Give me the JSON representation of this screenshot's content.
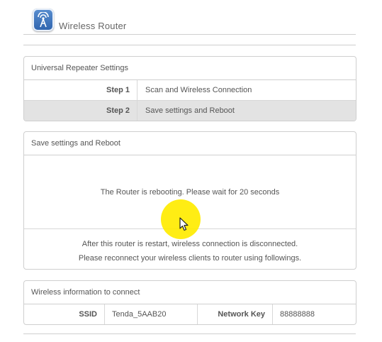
{
  "header": {
    "brand": "Wireless Router",
    "logo_icon": "wifi-tower-icon"
  },
  "repeater": {
    "title": "Universal Repeater Settings",
    "steps": [
      {
        "label": "Step 1",
        "text": "Scan and Wireless Connection",
        "active": false
      },
      {
        "label": "Step 2",
        "text": "Save settings and Reboot",
        "active": true
      }
    ]
  },
  "reboot": {
    "title": "Save settings and Reboot",
    "message": "The Router is rebooting. Please wait for 20 seconds",
    "note_line1": "After this router is restart, wireless connection is disconnected.",
    "note_line2": "Please reconnect your wireless clients to router using followings."
  },
  "wireless_info": {
    "title": "Wireless information to connect",
    "ssid_label": "SSID",
    "ssid_value": "Tenda_5AAB20",
    "key_label": "Network Key",
    "key_value": "88888888"
  },
  "colors": {
    "highlight": "#ffec00",
    "active_row": "#e3e3e3",
    "border": "#cfcfcf"
  }
}
